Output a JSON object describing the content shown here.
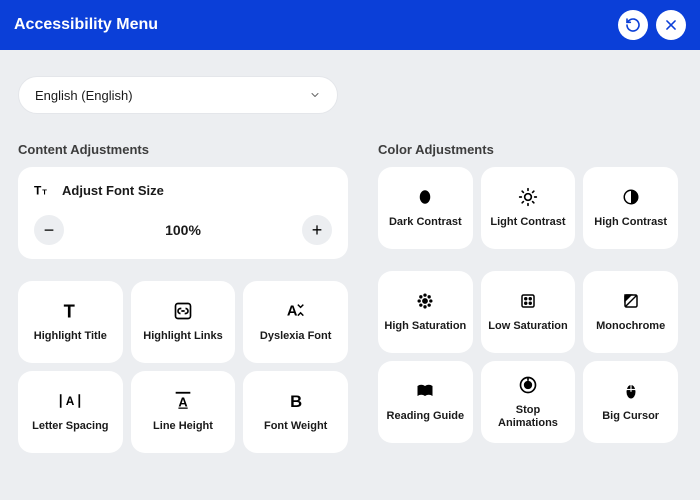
{
  "header": {
    "title": "Accessibility Menu"
  },
  "language": {
    "selected": "English (English)"
  },
  "sections": {
    "content_adjustments": "Content Adjustments",
    "color_adjustments": "Color Adjustments"
  },
  "font_card": {
    "label": "Adjust Font Size",
    "value": "100%"
  },
  "tiles": {
    "dark_contrast": "Dark Contrast",
    "light_contrast": "Light Contrast",
    "high_contrast": "High Contrast",
    "highlight_title": "Highlight Title",
    "highlight_links": "Highlight Links",
    "dyslexia_font": "Dyslexia Font",
    "high_saturation": "High Saturation",
    "low_saturation": "Low Saturation",
    "monochrome": "Monochrome",
    "letter_spacing": "Letter Spacing",
    "line_height": "Line Height",
    "font_weight": "Font Weight",
    "reading_guide": "Reading Guide",
    "stop_animations": "Stop Animations",
    "big_cursor": "Big Cursor"
  }
}
